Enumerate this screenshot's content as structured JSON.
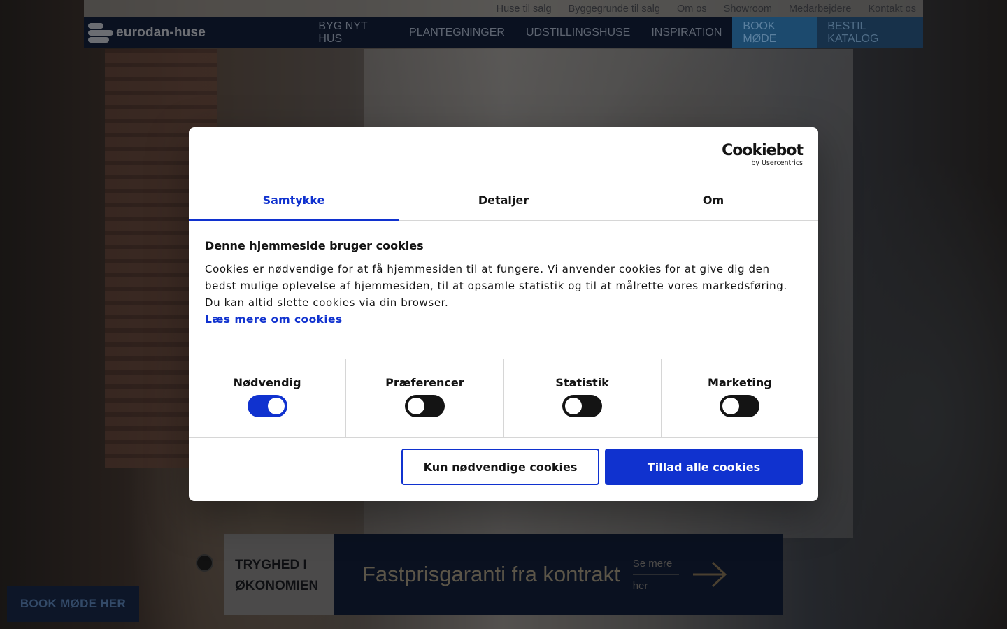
{
  "topbar": {
    "links": [
      "Huse til salg",
      "Byggegrunde til salg",
      "Om os",
      "Showroom",
      "Medarbejdere",
      "Kontakt os"
    ]
  },
  "header": {
    "logo_text": "eurodan-huse",
    "nav": [
      "BYG NYT HUS",
      "PLANTEGNINGER",
      "UDSTILLINGSHUSE",
      "INSPIRATION",
      "BOOK MØDE",
      "BESTIL KATALOG"
    ]
  },
  "promo": {
    "label_line1": "TRYGHED I",
    "label_line2": "ØKONOMIEN",
    "title": "Fastprisgaranti fra kontrakt",
    "more_line1": "Se mere",
    "more_line2": "her"
  },
  "book_button": "BOOK MØDE HER",
  "cookie": {
    "brand": "Cookiebot",
    "brand_sub": "by Usercentrics",
    "tabs": [
      "Samtykke",
      "Detaljer",
      "Om"
    ],
    "heading": "Denne hjemmeside bruger cookies",
    "text": "Cookies er nødvendige for at få hjemmesiden til at fungere. Vi anvender cookies for at give dig den bedst mulige oplevelse af hjemmesiden, til at opsamle statistik og til at målrette vores markedsføring. Du kan altid slette cookies via din browser.",
    "link": "Læs mere om cookies",
    "categories": [
      {
        "label": "Nødvendig",
        "on": true
      },
      {
        "label": "Præferencer",
        "on": false
      },
      {
        "label": "Statistik",
        "on": false
      },
      {
        "label": "Marketing",
        "on": false
      }
    ],
    "btn_necessary": "Kun nødvendige cookies",
    "btn_all": "Tillad alle cookies",
    "accent_color": "#1032cf"
  }
}
